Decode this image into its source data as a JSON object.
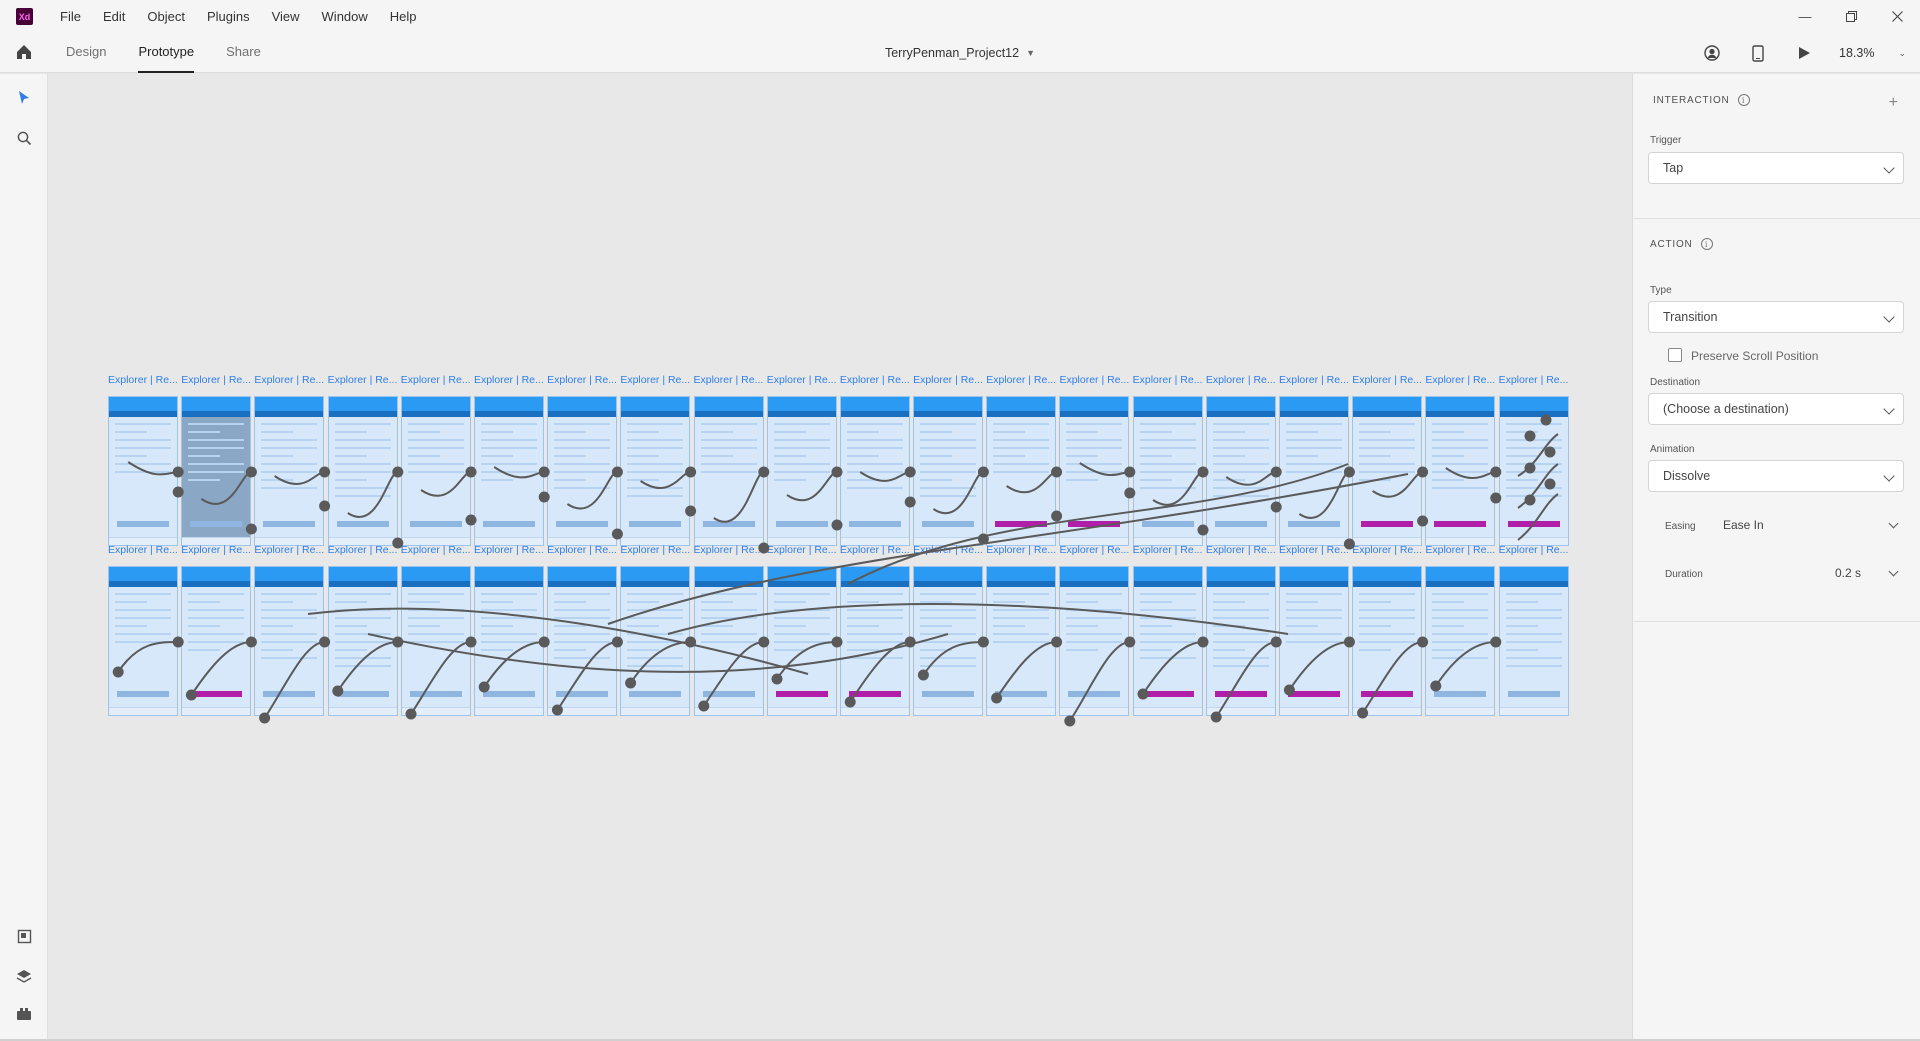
{
  "app": {
    "logo_text": "Xd",
    "menu": [
      "File",
      "Edit",
      "Object",
      "Plugins",
      "View",
      "Window",
      "Help"
    ]
  },
  "toolbar": {
    "tabs": [
      {
        "label": "Design",
        "active": false
      },
      {
        "label": "Prototype",
        "active": true
      },
      {
        "label": "Share",
        "active": false
      }
    ],
    "document_title": "TerryPenman_Project12",
    "zoom": "18.3%"
  },
  "canvas": {
    "artboard_label": "Explorer | Re...",
    "row_count": 2,
    "artboards_per_row": 20
  },
  "panel": {
    "interaction_title": "INTERACTION",
    "trigger_label": "Trigger",
    "trigger_value": "Tap",
    "action_title": "ACTION",
    "type_label": "Type",
    "type_value": "Transition",
    "preserve_scroll_label": "Preserve Scroll Position",
    "preserve_scroll_checked": false,
    "destination_label": "Destination",
    "destination_value": "(Choose a destination)",
    "animation_label": "Animation",
    "animation_value": "Dissolve",
    "easing_label": "Easing",
    "easing_value": "Ease In",
    "duration_label": "Duration",
    "duration_value": "0.2 s"
  },
  "colors": {
    "accent": "#2f7fe8",
    "wire": "#5a5a5a",
    "artboard_header": "#2b9af3",
    "magenta_button": "#b11ea7"
  }
}
